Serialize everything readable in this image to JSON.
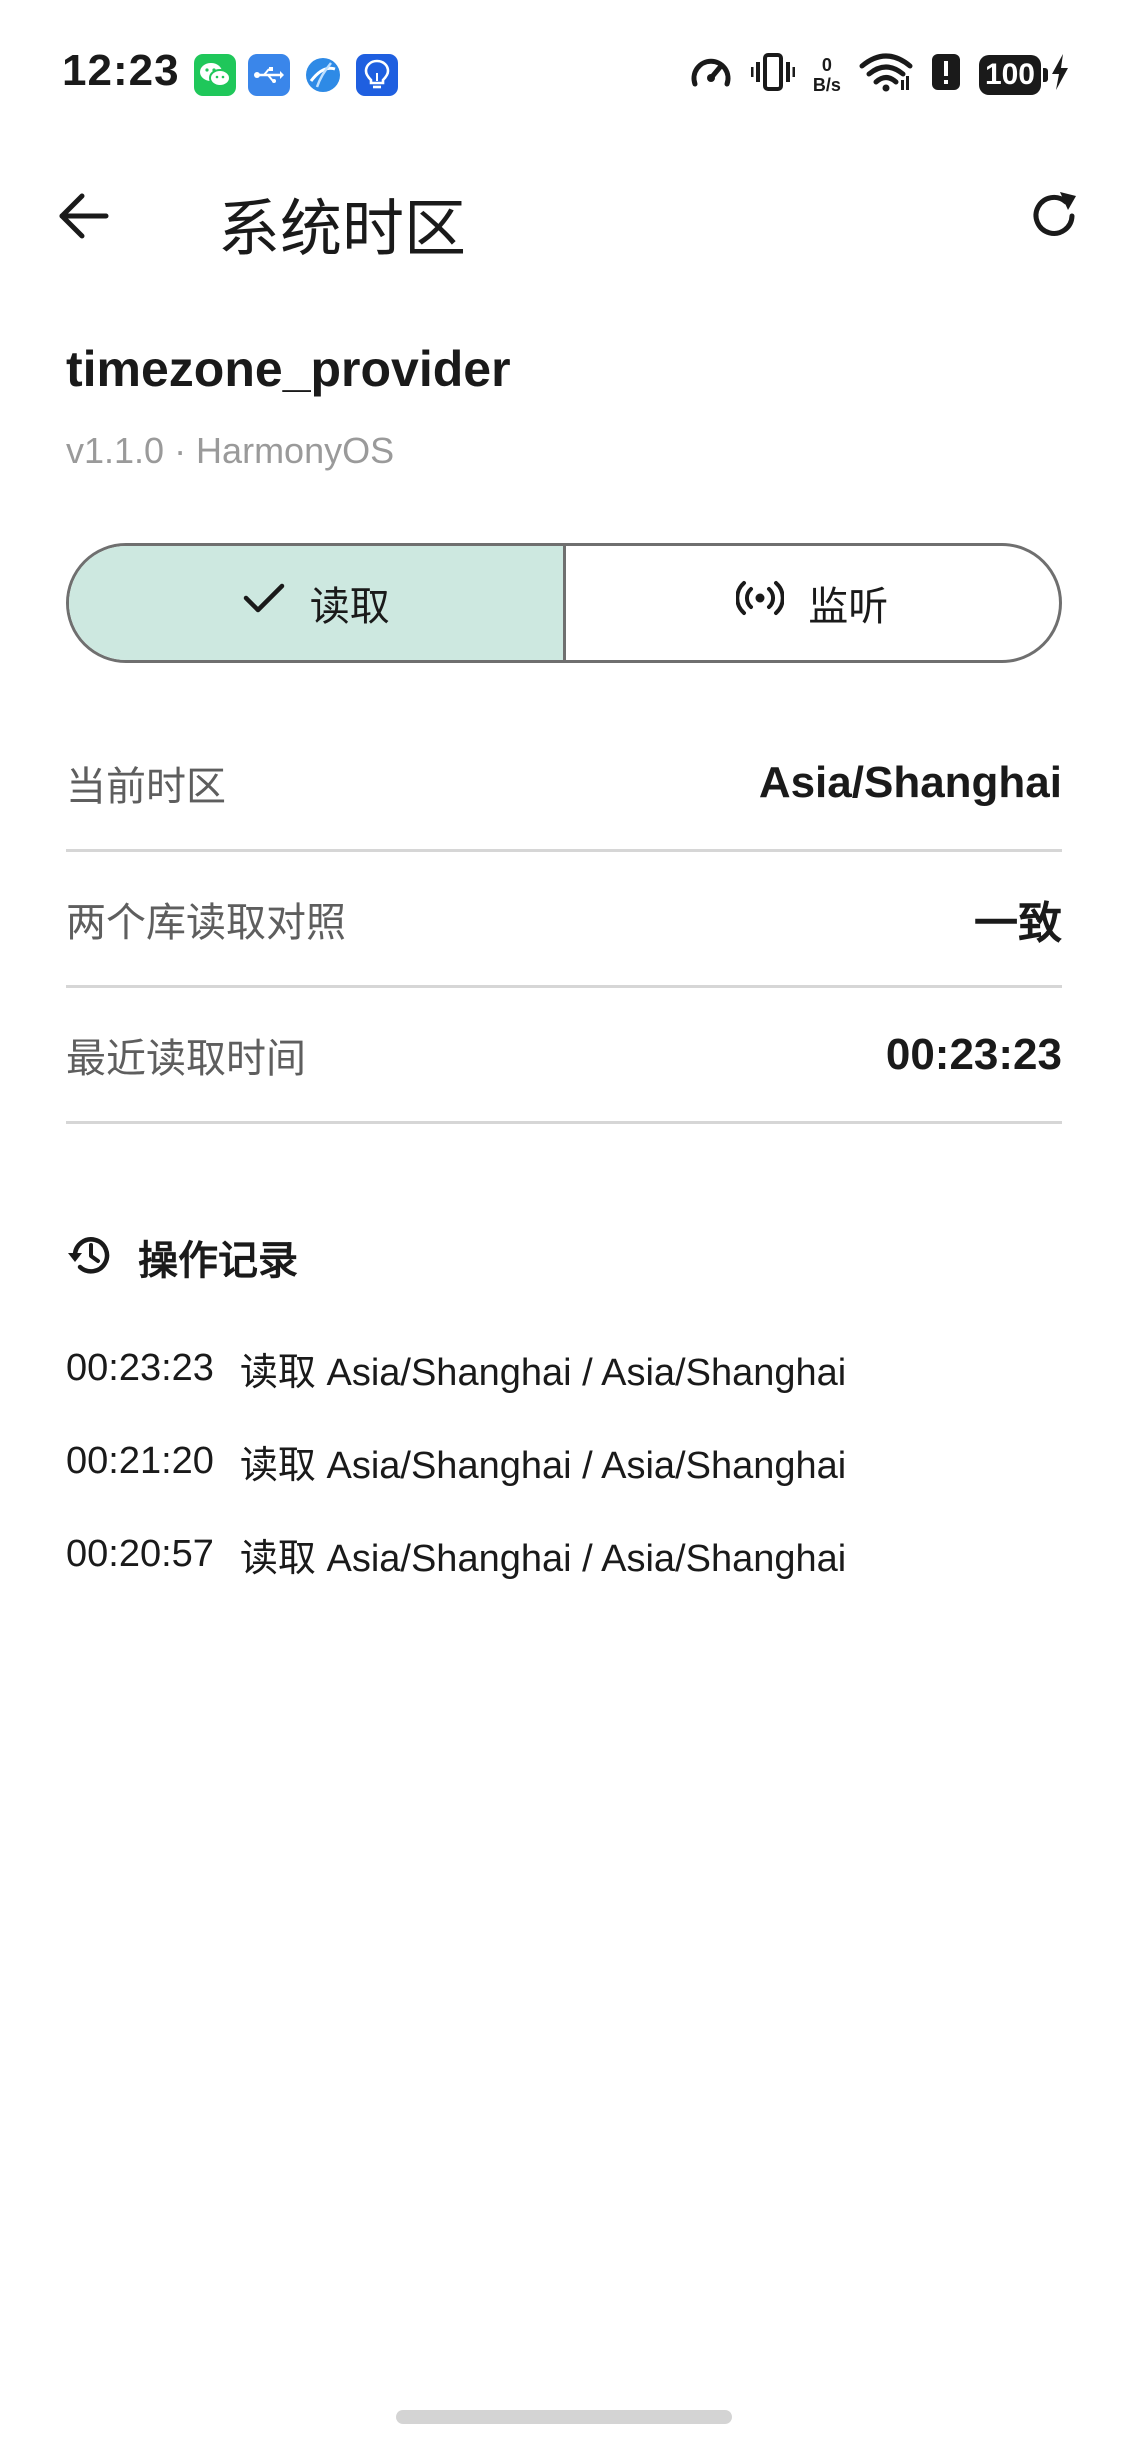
{
  "status_bar": {
    "time": "12:23",
    "notification_icons": [
      "wechat-icon",
      "usb-icon",
      "browser-icon",
      "bulb-app-icon"
    ],
    "system_icons": [
      "speedometer-icon",
      "vibrate-icon",
      "wifi-icon",
      "alert-icon"
    ],
    "net_speed_value": "0",
    "net_speed_unit": "B/s",
    "battery_level": "100",
    "charging": true
  },
  "app_bar": {
    "title": "系统时区",
    "back_icon": "arrow-left-icon",
    "refresh_icon": "refresh-icon"
  },
  "provider": {
    "name": "timezone_provider",
    "meta": "v1.1.0 · HarmonyOS"
  },
  "segmented": {
    "read_label": "读取",
    "listen_label": "监听",
    "active": "read"
  },
  "info_rows": [
    {
      "label": "当前时区",
      "value": "Asia/Shanghai"
    },
    {
      "label": "两个库读取对照",
      "value": "一致"
    },
    {
      "label": "最近读取时间",
      "value": "00:23:23"
    }
  ],
  "log": {
    "title": "操作记录",
    "items": [
      {
        "time": "00:23:23",
        "text": "读取 Asia/Shanghai / Asia/Shanghai"
      },
      {
        "time": "00:21:20",
        "text": "读取 Asia/Shanghai / Asia/Shanghai"
      },
      {
        "time": "00:20:57",
        "text": "读取 Asia/Shanghai / Asia/Shanghai"
      }
    ]
  },
  "colors": {
    "accent_bg": "#cde8e0",
    "text_primary": "#1a1a1a",
    "text_secondary": "#5e5e5e",
    "text_muted": "#9a9a9a",
    "divider": "#d6d6d6"
  }
}
